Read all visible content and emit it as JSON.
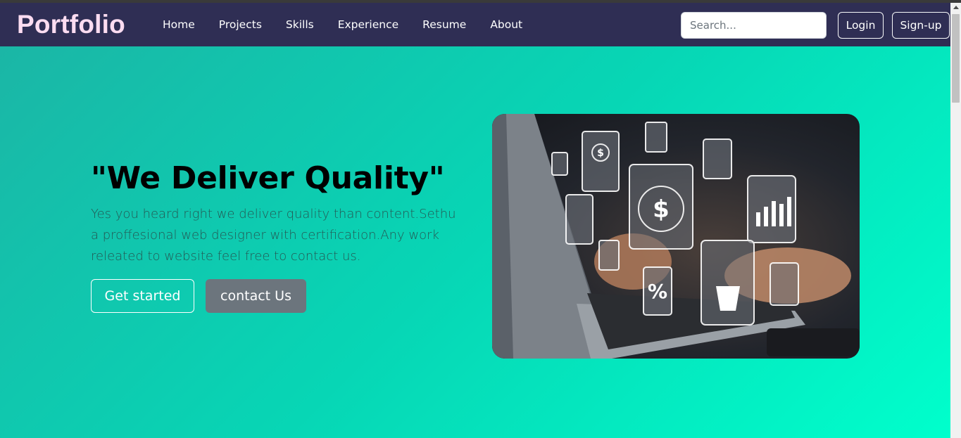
{
  "navbar": {
    "brand": "Portfolio",
    "links": [
      "Home",
      "Projects",
      "Skills",
      "Experience",
      "Resume",
      "About"
    ],
    "search_placeholder": "Search...",
    "login_label": "Login",
    "signup_label": "Sign-up"
  },
  "hero": {
    "title": "\"We Deliver Quality\"",
    "description": "Yes you heard right we deliver quality than content.Sethu a proffesional web designer with certification.Any work releated to website feel free to contact us.",
    "get_started_label": "Get started",
    "contact_label": "contact Us"
  },
  "colors": {
    "navbar_bg": "#2f2e54",
    "brand": "#fcdcf1",
    "hero_gradient_start": "#1bb6a6",
    "hero_gradient_end": "#00ffcc",
    "contact_button": "#6c757d"
  }
}
